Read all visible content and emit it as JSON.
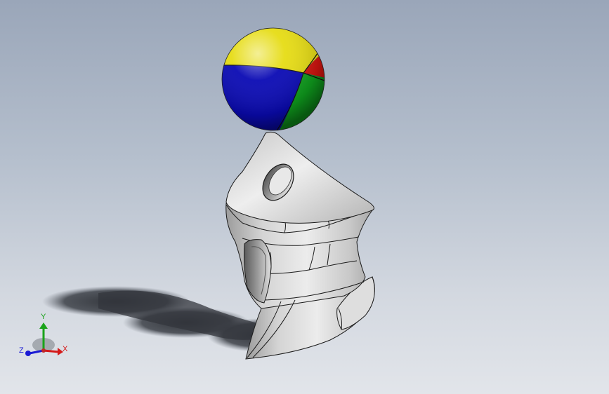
{
  "viewport": {
    "background_top": "#9aa6b9",
    "background_bottom": "#e2e5ea"
  },
  "model": {
    "ball_colors": {
      "yellow": "#e6dc14",
      "red": "#d4140f",
      "blue": "#0a0ab4",
      "green": "#0fa01e"
    },
    "body_color": "#d9d9d9"
  },
  "triad": {
    "x_label": "X",
    "y_label": "Y",
    "z_label": "Z",
    "x_color": "#d41a1a",
    "y_color": "#1aa31a",
    "z_color": "#1a1ad4"
  }
}
